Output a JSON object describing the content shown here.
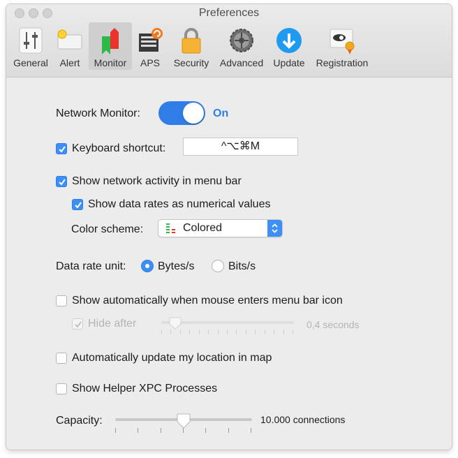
{
  "window": {
    "title": "Preferences"
  },
  "tabs": [
    {
      "label": "General",
      "icon": "sliders-icon"
    },
    {
      "label": "Alert",
      "icon": "alert-banner-icon"
    },
    {
      "label": "Monitor",
      "icon": "monitor-bars-icon",
      "selected": true
    },
    {
      "label": "APS",
      "icon": "aps-list-icon"
    },
    {
      "label": "Security",
      "icon": "padlock-icon"
    },
    {
      "label": "Advanced",
      "icon": "gear-icon"
    },
    {
      "label": "Update",
      "icon": "download-arrow-icon"
    },
    {
      "label": "Registration",
      "icon": "certificate-icon"
    }
  ],
  "network_monitor": {
    "label": "Network Monitor:",
    "state": "On",
    "on": true
  },
  "keyboard_shortcut": {
    "label": "Keyboard shortcut:",
    "checked": true,
    "value": "^⌥⌘M"
  },
  "menu_bar_activity": {
    "label": "Show network activity in menu bar",
    "checked": true
  },
  "numerical_values": {
    "label": "Show data rates as numerical values",
    "checked": true
  },
  "color_scheme": {
    "label": "Color scheme:",
    "value": "Colored"
  },
  "data_rate_unit": {
    "label": "Data rate unit:",
    "options": [
      "Bytes/s",
      "Bits/s"
    ],
    "selected": "Bytes/s"
  },
  "auto_show": {
    "label": "Show automatically when mouse enters menu bar icon",
    "checked": false
  },
  "hide_after": {
    "label": "Hide after",
    "checked": true,
    "enabled": false,
    "value_text": "0,4 seconds",
    "level": 0.05
  },
  "auto_location": {
    "label": "Automatically update my location in map",
    "checked": false
  },
  "helper_xpc": {
    "label": "Show Helper XPC Processes",
    "checked": false
  },
  "capacity": {
    "label": "Capacity:",
    "value_text": "10.000 connections",
    "level": 0.5
  },
  "colors": {
    "accent": "#2f7de6",
    "window_bg": "#ececec"
  }
}
